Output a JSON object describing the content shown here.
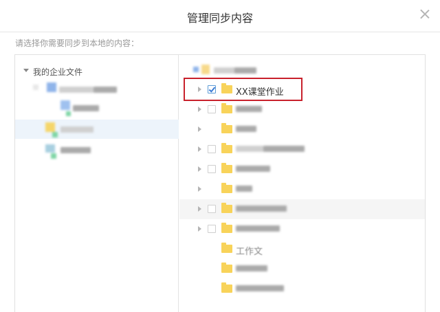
{
  "dialog": {
    "title": "管理同步内容",
    "prompt": "请选择你需要同步到本地的内容："
  },
  "left_tree": {
    "root_label": "我的企业文件"
  },
  "right_list": {
    "items": [
      {
        "label": "XX课堂作业",
        "checked": true,
        "highlighted": true
      },
      {
        "label": "",
        "checked": false
      },
      {
        "label": "",
        "checked": false
      },
      {
        "label": "",
        "checked": false
      },
      {
        "label": "",
        "checked": false
      },
      {
        "label": "",
        "checked": false
      },
      {
        "label": "",
        "checked": false
      },
      {
        "label": "",
        "checked": false
      },
      {
        "label": "工作文",
        "checked": false
      },
      {
        "label": "",
        "checked": false
      },
      {
        "label": "",
        "checked": false
      }
    ]
  },
  "colors": {
    "highlight": "#c8202b",
    "folder": "#f8d35a",
    "checkbox_accent": "#3a7bd5",
    "selected_row": "#edf4fb"
  }
}
